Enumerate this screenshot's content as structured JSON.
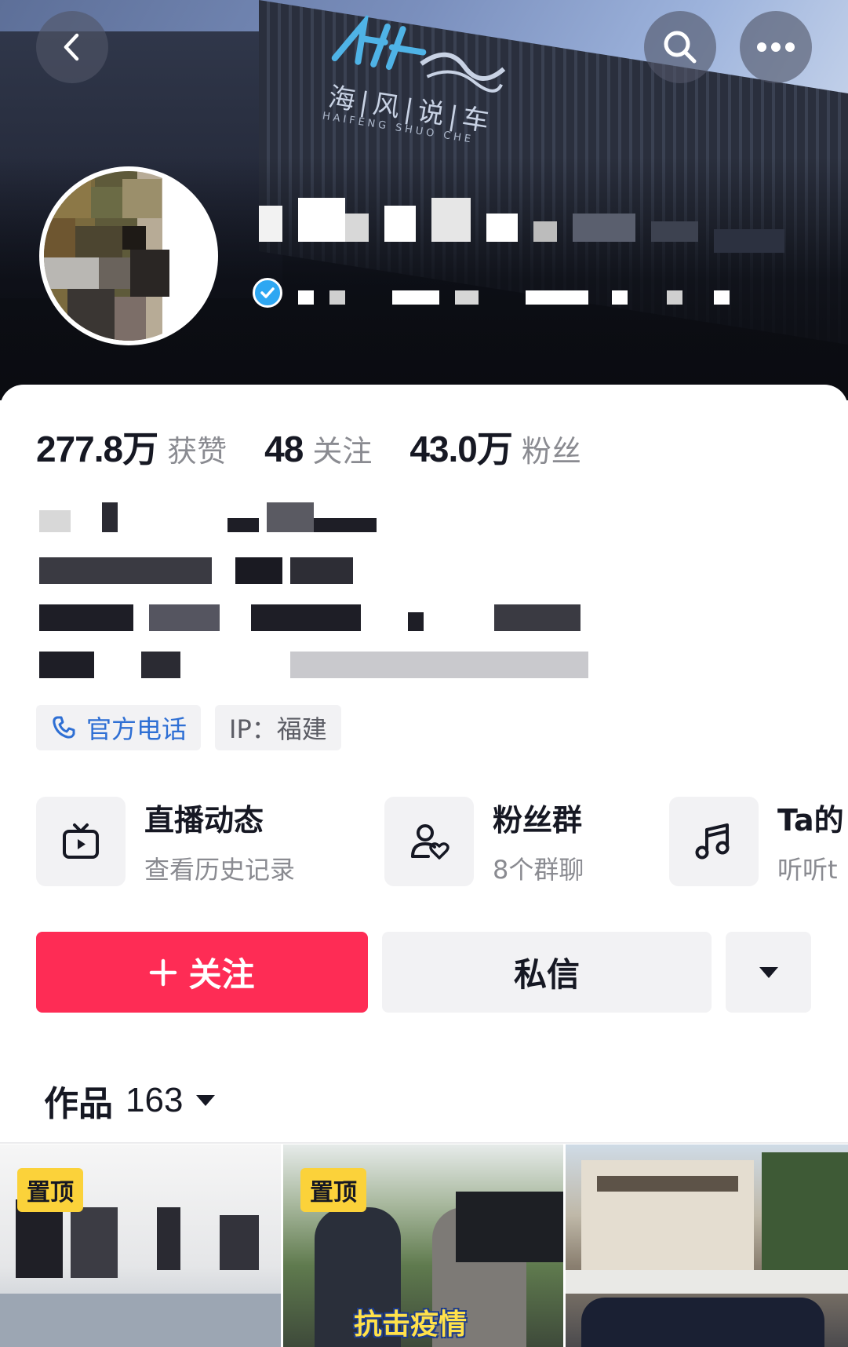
{
  "banner": {
    "logo_text": "海|风|说|车",
    "logo_sub": "HAIFENG SHUO CHE"
  },
  "icons": {
    "back": "chevron-left-icon",
    "search": "search-icon",
    "more": "more-icon",
    "verified": "verified-badge-icon",
    "phone": "phone-icon",
    "live": "tv-play-icon",
    "fans_group": "user-heart-icon",
    "music": "music-note-icon",
    "dropdown": "caret-down-icon"
  },
  "stats": [
    {
      "value": "277.8万",
      "label": "获赞"
    },
    {
      "value": "48",
      "label": "关注"
    },
    {
      "value": "43.0万",
      "label": "粉丝"
    }
  ],
  "tags": {
    "phone": "官方电话",
    "ip": "IP：福建"
  },
  "features": [
    {
      "title": "直播动态",
      "subtitle": "查看历史记录"
    },
    {
      "title": "粉丝群",
      "subtitle": "8个群聊"
    },
    {
      "title": "Ta的",
      "subtitle": "听听t"
    }
  ],
  "actions": {
    "follow": "关注",
    "message": "私信"
  },
  "works": {
    "label": "作品",
    "count": "163"
  },
  "thumbnails": [
    {
      "pin": "置顶"
    },
    {
      "pin": "置顶",
      "caption": "抗击疫情"
    },
    {}
  ],
  "colors": {
    "accent": "#fe2c55",
    "pin": "#fbd23a",
    "verified": "#2ea7f2",
    "link": "#2e6fd4"
  }
}
